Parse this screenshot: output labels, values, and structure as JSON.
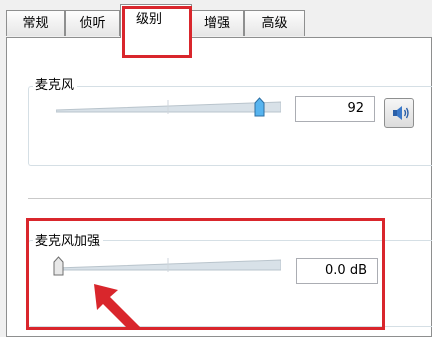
{
  "tabs": [
    {
      "label": "常规"
    },
    {
      "label": "侦听"
    },
    {
      "label": "级别"
    },
    {
      "label": "增强"
    },
    {
      "label": "高级"
    }
  ],
  "active_tab": "级别",
  "microphone": {
    "label": "麦克风",
    "value_text": "92",
    "level_fraction": 0.92
  },
  "boost": {
    "label": "麦克风加强",
    "value_text": "0.0 dB",
    "level_fraction": 0.0
  },
  "colors": {
    "highlight": "#d9262c",
    "thumb_blue": "#2d8fd6"
  },
  "icons": {
    "speaker_button": "speaker-icon",
    "pointer": "arrow-icon"
  }
}
